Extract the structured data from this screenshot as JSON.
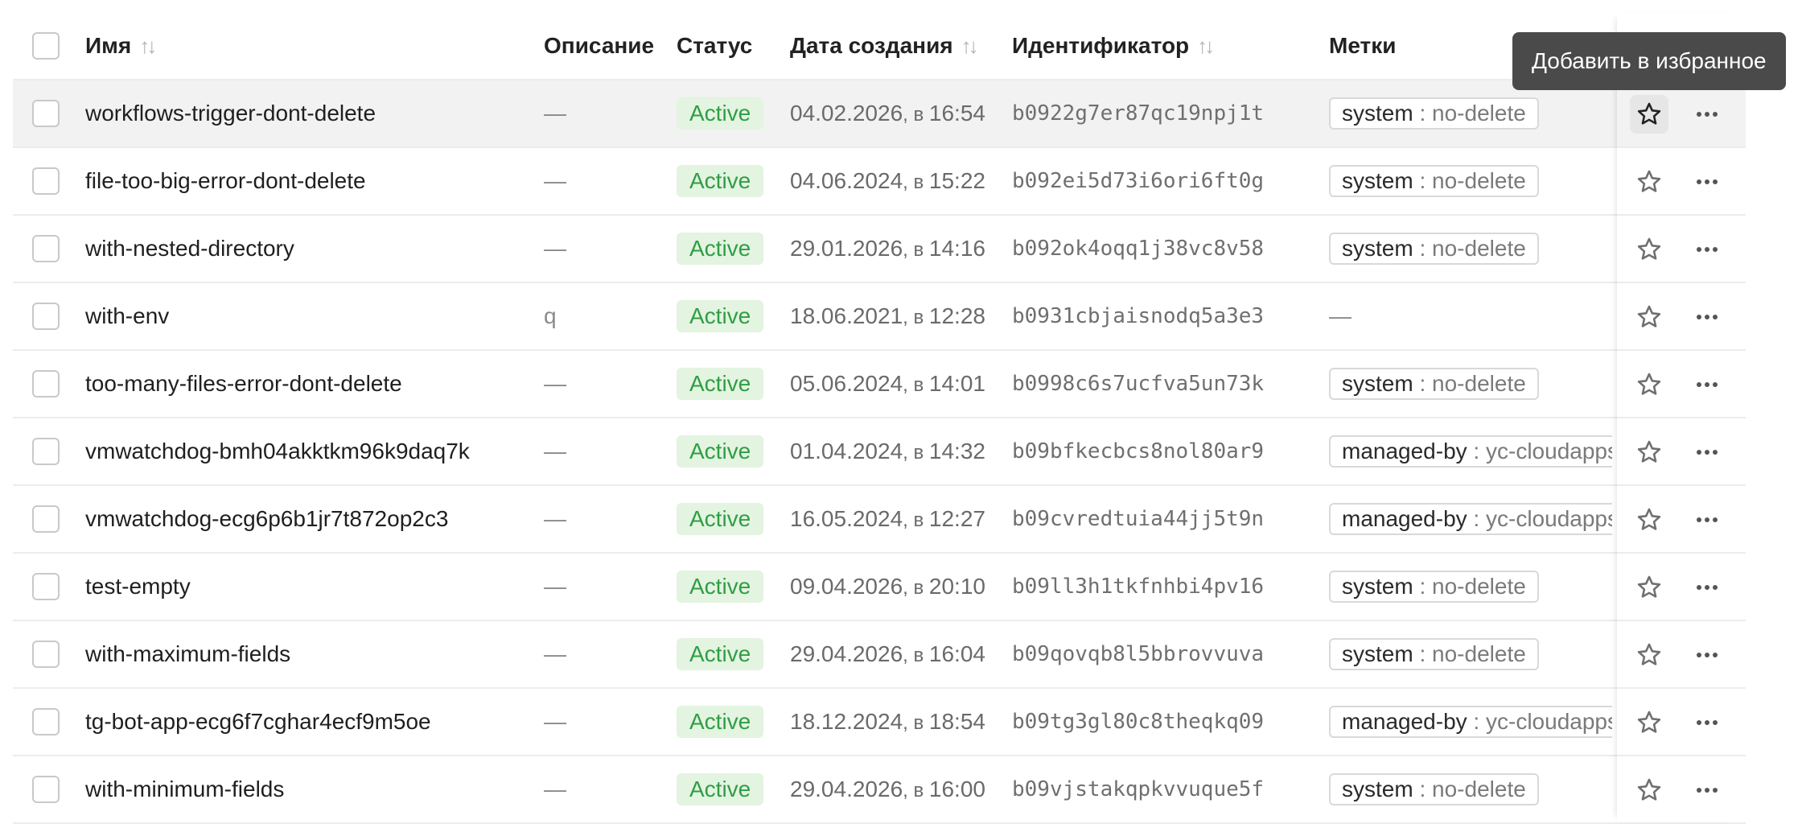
{
  "header": {
    "name": "Имя",
    "description": "Описание",
    "status": "Статус",
    "created": "Дата создания",
    "identifier": "Идентификатор",
    "labels": "Метки"
  },
  "tooltip": "Добавить в избранное",
  "rows": [
    {
      "name": "workflows-trigger-dont-delete",
      "description": "—",
      "status": "Active",
      "date": "04.02.2026",
      "sep": ", в ",
      "time": "16:54",
      "id": "b0922g7er87qc19npj1t",
      "tag_key": "system",
      "tag_value": "no-delete",
      "has_tag": true
    },
    {
      "name": "file-too-big-error-dont-delete",
      "description": "—",
      "status": "Active",
      "date": "04.06.2024",
      "sep": ", в ",
      "time": "15:22",
      "id": "b092ei5d73i6ori6ft0g",
      "tag_key": "system",
      "tag_value": "no-delete",
      "has_tag": true
    },
    {
      "name": "with-nested-directory",
      "description": "—",
      "status": "Active",
      "date": "29.01.2026",
      "sep": ", в ",
      "time": "14:16",
      "id": "b092ok4oqq1j38vc8v58",
      "tag_key": "system",
      "tag_value": "no-delete",
      "has_tag": true
    },
    {
      "name": "with-env",
      "description": "q",
      "status": "Active",
      "date": "18.06.2021",
      "sep": ", в ",
      "time": "12:28",
      "id": "b0931cbjaisnodq5a3e3",
      "tag_key": "",
      "tag_value": "",
      "has_tag": false,
      "tag_empty": "—"
    },
    {
      "name": "too-many-files-error-dont-delete",
      "description": "—",
      "status": "Active",
      "date": "05.06.2024",
      "sep": ", в ",
      "time": "14:01",
      "id": "b0998c6s7ucfva5un73k",
      "tag_key": "system",
      "tag_value": "no-delete",
      "has_tag": true
    },
    {
      "name": "vmwatchdog-bmh04akktkm96k9daq7k",
      "description": "—",
      "status": "Active",
      "date": "01.04.2024",
      "sep": ", в ",
      "time": "14:32",
      "id": "b09bfkecbcs8nol80ar9",
      "tag_key": "managed-by",
      "tag_value": "yc-cloudapps",
      "has_tag": true
    },
    {
      "name": "vmwatchdog-ecg6p6b1jr7t872op2c3",
      "description": "—",
      "status": "Active",
      "date": "16.05.2024",
      "sep": ", в ",
      "time": "12:27",
      "id": "b09cvredtuia44jj5t9n",
      "tag_key": "managed-by",
      "tag_value": "yc-cloudapps",
      "has_tag": true
    },
    {
      "name": "test-empty",
      "description": "—",
      "status": "Active",
      "date": "09.04.2026",
      "sep": ", в ",
      "time": "20:10",
      "id": "b09ll3h1tkfnhbi4pv16",
      "tag_key": "system",
      "tag_value": "no-delete",
      "has_tag": true
    },
    {
      "name": "with-maximum-fields",
      "description": "—",
      "status": "Active",
      "date": "29.04.2026",
      "sep": ", в ",
      "time": "16:04",
      "id": "b09qovqb8l5bbrovvuva",
      "tag_key": "system",
      "tag_value": "no-delete",
      "has_tag": true
    },
    {
      "name": "tg-bot-app-ecg6f7cghar4ecf9m5oe",
      "description": "—",
      "status": "Active",
      "date": "18.12.2024",
      "sep": ", в ",
      "time": "18:54",
      "id": "b09tg3gl80c8theqkq09",
      "tag_key": "managed-by",
      "tag_value": "yc-cloudapps",
      "has_tag": true
    },
    {
      "name": "with-minimum-fields",
      "description": "—",
      "status": "Active",
      "date": "29.04.2026",
      "sep": ", в ",
      "time": "16:00",
      "id": "b09vjstakqpkvvuque5f",
      "tag_key": "system",
      "tag_value": "no-delete",
      "has_tag": true
    }
  ],
  "colors": {
    "status_text": "#2f9e44",
    "status_bg": "#e3f4e1",
    "hover_row": "#f2f2f2",
    "tooltip_bg": "#4a4a4a"
  },
  "icons": {
    "sort": "sort-arrows-icon",
    "favorite": "star-icon",
    "more": "ellipsis-icon"
  }
}
